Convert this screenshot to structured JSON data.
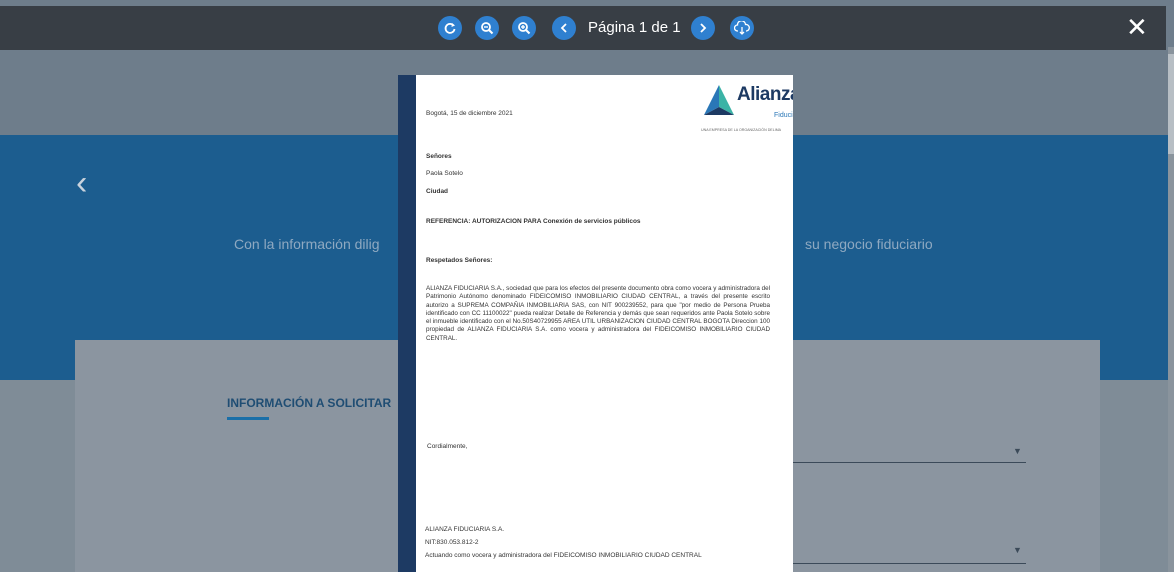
{
  "toolbar": {
    "buttons": [
      "rotate-icon",
      "zoom-out-icon",
      "zoom-in-icon",
      "previous-page-icon",
      "next-page-icon",
      "download-icon"
    ],
    "page_label": "Página 1 de 1",
    "close_label": "✕"
  },
  "background": {
    "back_glyph": "‹",
    "intro_left": "Con la información dilig",
    "intro_right": "su negocio fiduciario",
    "section_title": "INFORMACIÓN A SOLICITAR"
  },
  "document": {
    "date": "Bogotá, 15 de diciembre 2021",
    "logo": {
      "name": "Alianza",
      "sub": "Fiduciaria",
      "tagline": "UNA EMPRESA DE LA ORGANIZACIÓN DELIMA"
    },
    "salutation": "Señores",
    "recipient": "Paola Sotelo",
    "city": "Ciudad",
    "reference": "REFERENCIA: AUTORIZACION PARA Conexión de servicios públicos",
    "greeting": "Respetados Señores:",
    "body": "ALIANZA FIDUCIARIA S.A., sociedad que para los efectos del presente documento obra como vocera y administradora del Patrimonio Autónomo denominado FIDEICOMISO INMOBILIARIO CIUDAD CENTRAL, a través del presente escrito autorizo a SUPREMA COMPAÑIA INMOBILIARIA SAS, con NIT 900239552, para que \"por medio de Persona Prueba identificado con CC 11100022\" pueda realizar Detalle de Referencia y demás que sean requeridos ante Paola Sotelo sobre el inmueble identificado con el No.50S40729955 AREA UTIL URBANIZACION CIUDAD CENTRAL BOGOTA Direccion 100 propiedad de ALIANZA FIDUCIARIA S.A. como vocera y administradora del FIDEICOMISO INMOBILIARIO CIUDAD CENTRAL.",
    "closing": "Cordialmente,",
    "signer": "ALIANZA FIDUCIARIA S.A.",
    "nit": "NIT:830.053.812-2",
    "signer_role": "Actuando como vocera y administradora del FIDEICOMISO INMOBILIARIO CIUDAD CENTRAL"
  },
  "colors": {
    "toolbar_bg": "#383e45",
    "button_blue": "#2f80d0",
    "band_blue": "#1c5d8f",
    "spine_navy": "#1d3a63"
  }
}
